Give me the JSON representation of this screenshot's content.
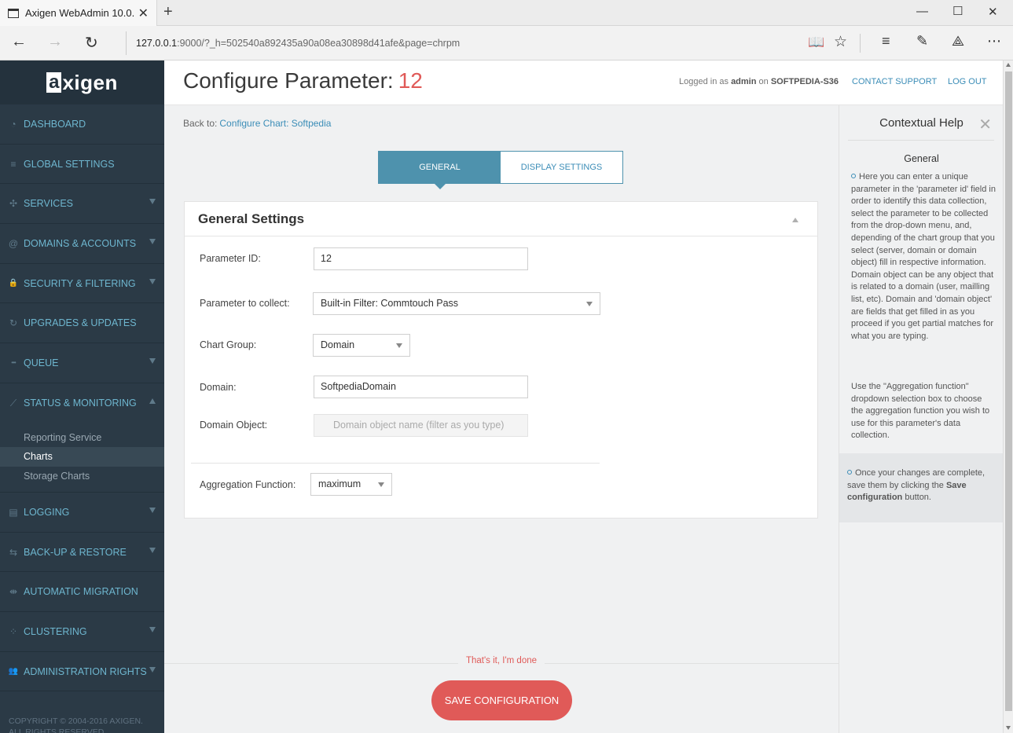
{
  "browser": {
    "tab_title": "Axigen WebAdmin 10.0.",
    "url_host": "127.0.0.1",
    "url_rest": ":9000/?_h=502540a892435a90a08ea30898d41afe&page=chrpm"
  },
  "brand": {
    "logo_a": "a",
    "logo_rest": "xigen"
  },
  "sidebar": {
    "items": [
      {
        "label": "DASHBOARD",
        "icon": "gauge-icon",
        "glyph": "◔"
      },
      {
        "label": "GLOBAL SETTINGS",
        "icon": "sliders-icon",
        "glyph": "≡"
      },
      {
        "label": "SERVICES",
        "icon": "network-icon",
        "glyph": "✣"
      },
      {
        "label": "DOMAINS & ACCOUNTS",
        "icon": "at-icon",
        "glyph": "@"
      },
      {
        "label": "SECURITY & FILTERING",
        "icon": "lock-icon",
        "glyph": "🔒"
      },
      {
        "label": "UPGRADES & UPDATES",
        "icon": "refresh-icon",
        "glyph": "↻"
      },
      {
        "label": "QUEUE",
        "icon": "queue-icon",
        "glyph": "•••"
      },
      {
        "label": "STATUS & MONITORING",
        "icon": "chart-icon",
        "glyph": "⟋"
      },
      {
        "label": "LOGGING",
        "icon": "document-icon",
        "glyph": "▤"
      },
      {
        "label": "BACK-UP & RESTORE",
        "icon": "backup-icon",
        "glyph": "⇆"
      },
      {
        "label": "AUTOMATIC MIGRATION",
        "icon": "migration-icon",
        "glyph": "⇼"
      },
      {
        "label": "CLUSTERING",
        "icon": "cluster-icon",
        "glyph": "⁘"
      },
      {
        "label": "ADMINISTRATION RIGHTS",
        "icon": "users-icon",
        "glyph": "👥"
      }
    ],
    "submenu": [
      "Reporting Service",
      "Charts",
      "Storage Charts"
    ],
    "copyright_1": "COPYRIGHT © 2004-2016 AXIGEN.",
    "copyright_2": "ALL RIGHTS RESERVED."
  },
  "header": {
    "title": "Configure Parameter:",
    "number": "12",
    "logged_prefix": "Logged in as",
    "user": "admin",
    "on": "on",
    "host": "SOFTPEDIA-S36",
    "contact": "CONTACT SUPPORT",
    "logout": "LOG OUT"
  },
  "content": {
    "back_label": "Back to:",
    "back_link": "Configure Chart: Softpedia",
    "tabs": [
      "GENERAL",
      "DISPLAY SETTINGS"
    ],
    "card_title": "General Settings",
    "fields": {
      "param_id_label": "Parameter ID:",
      "param_id_value": "12",
      "collect_label": "Parameter to collect:",
      "collect_value": "Built-in Filter: Commtouch Pass",
      "group_label": "Chart Group:",
      "group_value": "Domain",
      "domain_label": "Domain:",
      "domain_value": "SoftpediaDomain",
      "object_label": "Domain Object:",
      "object_placeholder": "Domain object name (filter as you type)",
      "agg_label": "Aggregation Function:",
      "agg_value": "maximum"
    },
    "done_text": "That's it, I'm done",
    "save_label": "SAVE CONFIGURATION"
  },
  "help": {
    "title": "Contextual Help",
    "subtitle": "General",
    "p1": "Here you can enter a unique parameter in the 'parameter id' field in order to identify this data collection, select the parameter to be collected from the drop-down menu, and, depending of the chart group that you select (server, domain or domain object) fill in respective information. Domain object can be any object that is related to a domain (user, mailling list, etc). Domain and 'domain object' are fields that get filled in as you proceed if you get partial matches for what you are typing.",
    "p2": "Use the \"Aggregation function\" dropdown selection box to choose the aggregation function you wish to use for this parameter's data collection.",
    "p3_pre": "Once your changes are complete, save them by clicking the",
    "p3_bold": "Save configuration",
    "p3_post": "button."
  }
}
